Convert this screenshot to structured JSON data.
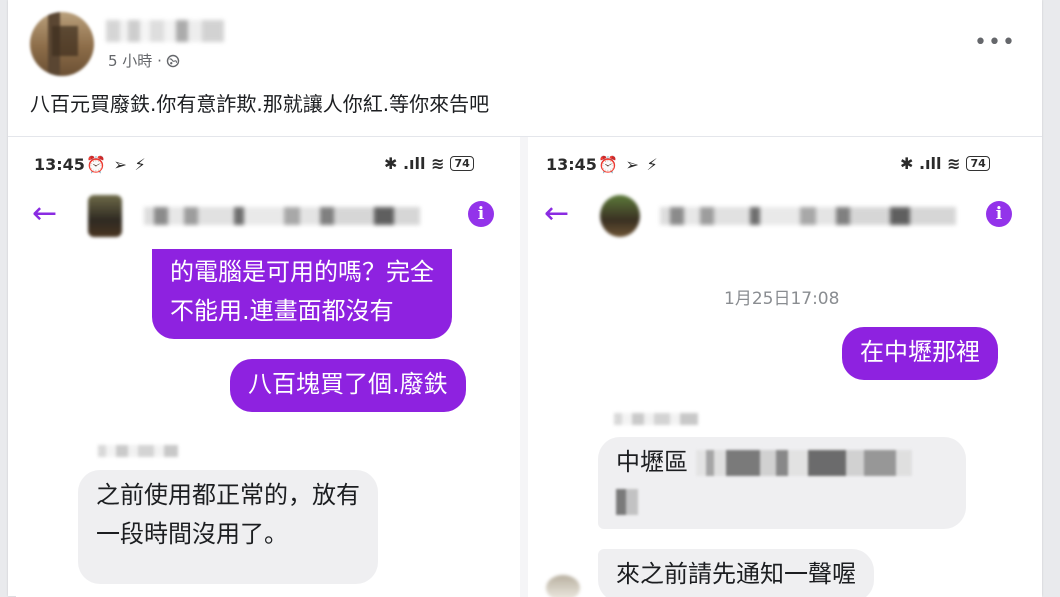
{
  "post": {
    "time": "5 小時 ·",
    "caption": "八百元買廢鉄.你有意詐欺.那就讓人你紅.等你來告吧",
    "more_icon": "more-dots-icon",
    "audience_icon": "globe-icon"
  },
  "left_screenshot": {
    "status_time": "13:45",
    "status_icons_left": "⏰ ➢ ⚡",
    "status_icons_right": "✱ .ıll ≋",
    "battery": "74",
    "messages": [
      {
        "direction": "out",
        "lines": [
          "的電腦是可用的嗎？完全",
          "不能用.連畫面都沒有"
        ]
      },
      {
        "direction": "out",
        "lines": [
          "八百塊買了個.廢鉄"
        ]
      },
      {
        "direction": "in",
        "lines": [
          "之前使用都正常的，放有",
          "一段時間沒用了。"
        ]
      }
    ]
  },
  "right_screenshot": {
    "status_time": "13:45",
    "status_icons_left": "⏰ ➢ ⚡",
    "status_icons_right": "✱ .ıll ≋",
    "battery": "74",
    "date_stamp": "1月25日17:08",
    "messages": [
      {
        "direction": "out",
        "lines": [
          "在中壢那裡"
        ]
      },
      {
        "direction": "in",
        "lines": [
          "中壢區"
        ]
      },
      {
        "direction": "in",
        "lines": [
          "來之前請先通知一聲喔"
        ]
      }
    ]
  },
  "colors": {
    "accent": "#8e22e0",
    "incoming_bubble": "#efeff1",
    "timestamp": "#8a8d91"
  }
}
